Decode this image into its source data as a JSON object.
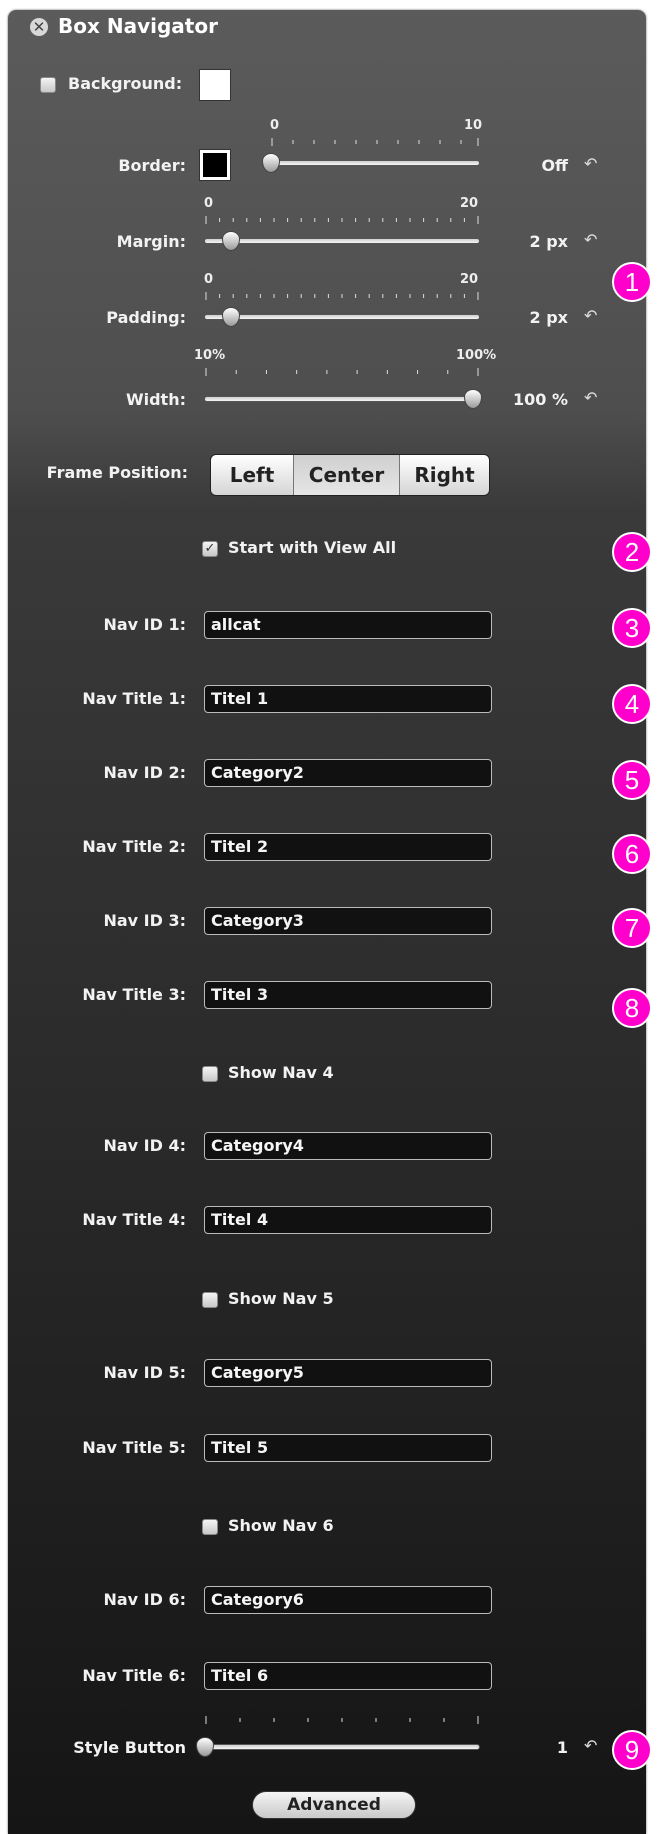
{
  "window": {
    "title": "Box Navigator"
  },
  "background": {
    "label": "Background:",
    "checked": false,
    "swatch_color": "#ffffff"
  },
  "border": {
    "label": "Border:",
    "min": "0",
    "max": "10",
    "value_text": "Off",
    "value": 0,
    "swatch_color": "#000000"
  },
  "margin": {
    "label": "Margin:",
    "min": "0",
    "max": "20",
    "value_text": "2 px",
    "value": 2
  },
  "padding": {
    "label": "Padding:",
    "min": "0",
    "max": "20",
    "value_text": "2 px",
    "value": 2
  },
  "width": {
    "label": "Width:",
    "min": "10%",
    "max": "100%",
    "value_text": "100 %",
    "value": 100
  },
  "frame_position": {
    "label": "Frame Position:",
    "options": [
      "Left",
      "Center",
      "Right"
    ],
    "selected": "Center"
  },
  "start_view_all": {
    "label": "Start with View All",
    "checked": true
  },
  "nav": {
    "id1_label": "Nav ID 1:",
    "id1_value": "allcat",
    "title1_label": "Nav Title 1:",
    "title1_value": "Titel 1",
    "id2_label": "Nav ID 2:",
    "id2_value": "Category2",
    "title2_label": "Nav Title 2:",
    "title2_value": "Titel 2",
    "id3_label": "Nav ID 3:",
    "id3_value": "Category3",
    "title3_label": "Nav Title 3:",
    "title3_value": "Titel 3",
    "show4_label": "Show Nav 4",
    "id4_label": "Nav ID 4:",
    "id4_value": "Category4",
    "title4_label": "Nav Title 4:",
    "title4_value": "Titel 4",
    "show5_label": "Show Nav 5",
    "id5_label": "Nav ID 5:",
    "id5_value": "Category5",
    "title5_label": "Nav Title 5:",
    "title5_value": "Titel 5",
    "show6_label": "Show Nav 6",
    "id6_label": "Nav ID 6:",
    "id6_value": "Category6",
    "title6_label": "Nav Title 6:",
    "title6_value": "Titel 6"
  },
  "style_button": {
    "label": "Style Button",
    "value_text": "1",
    "value": 1
  },
  "advanced": {
    "label": "Advanced"
  },
  "badges": [
    "1",
    "2",
    "3",
    "4",
    "5",
    "6",
    "7",
    "8",
    "9"
  ],
  "icons": {
    "close": "close-icon",
    "reset": "reset-arrow-icon",
    "check": "checkmark-icon"
  },
  "colors": {
    "badge": "#ff00cc",
    "panel_top": "#5b5b5b",
    "panel_bottom": "#151515"
  }
}
